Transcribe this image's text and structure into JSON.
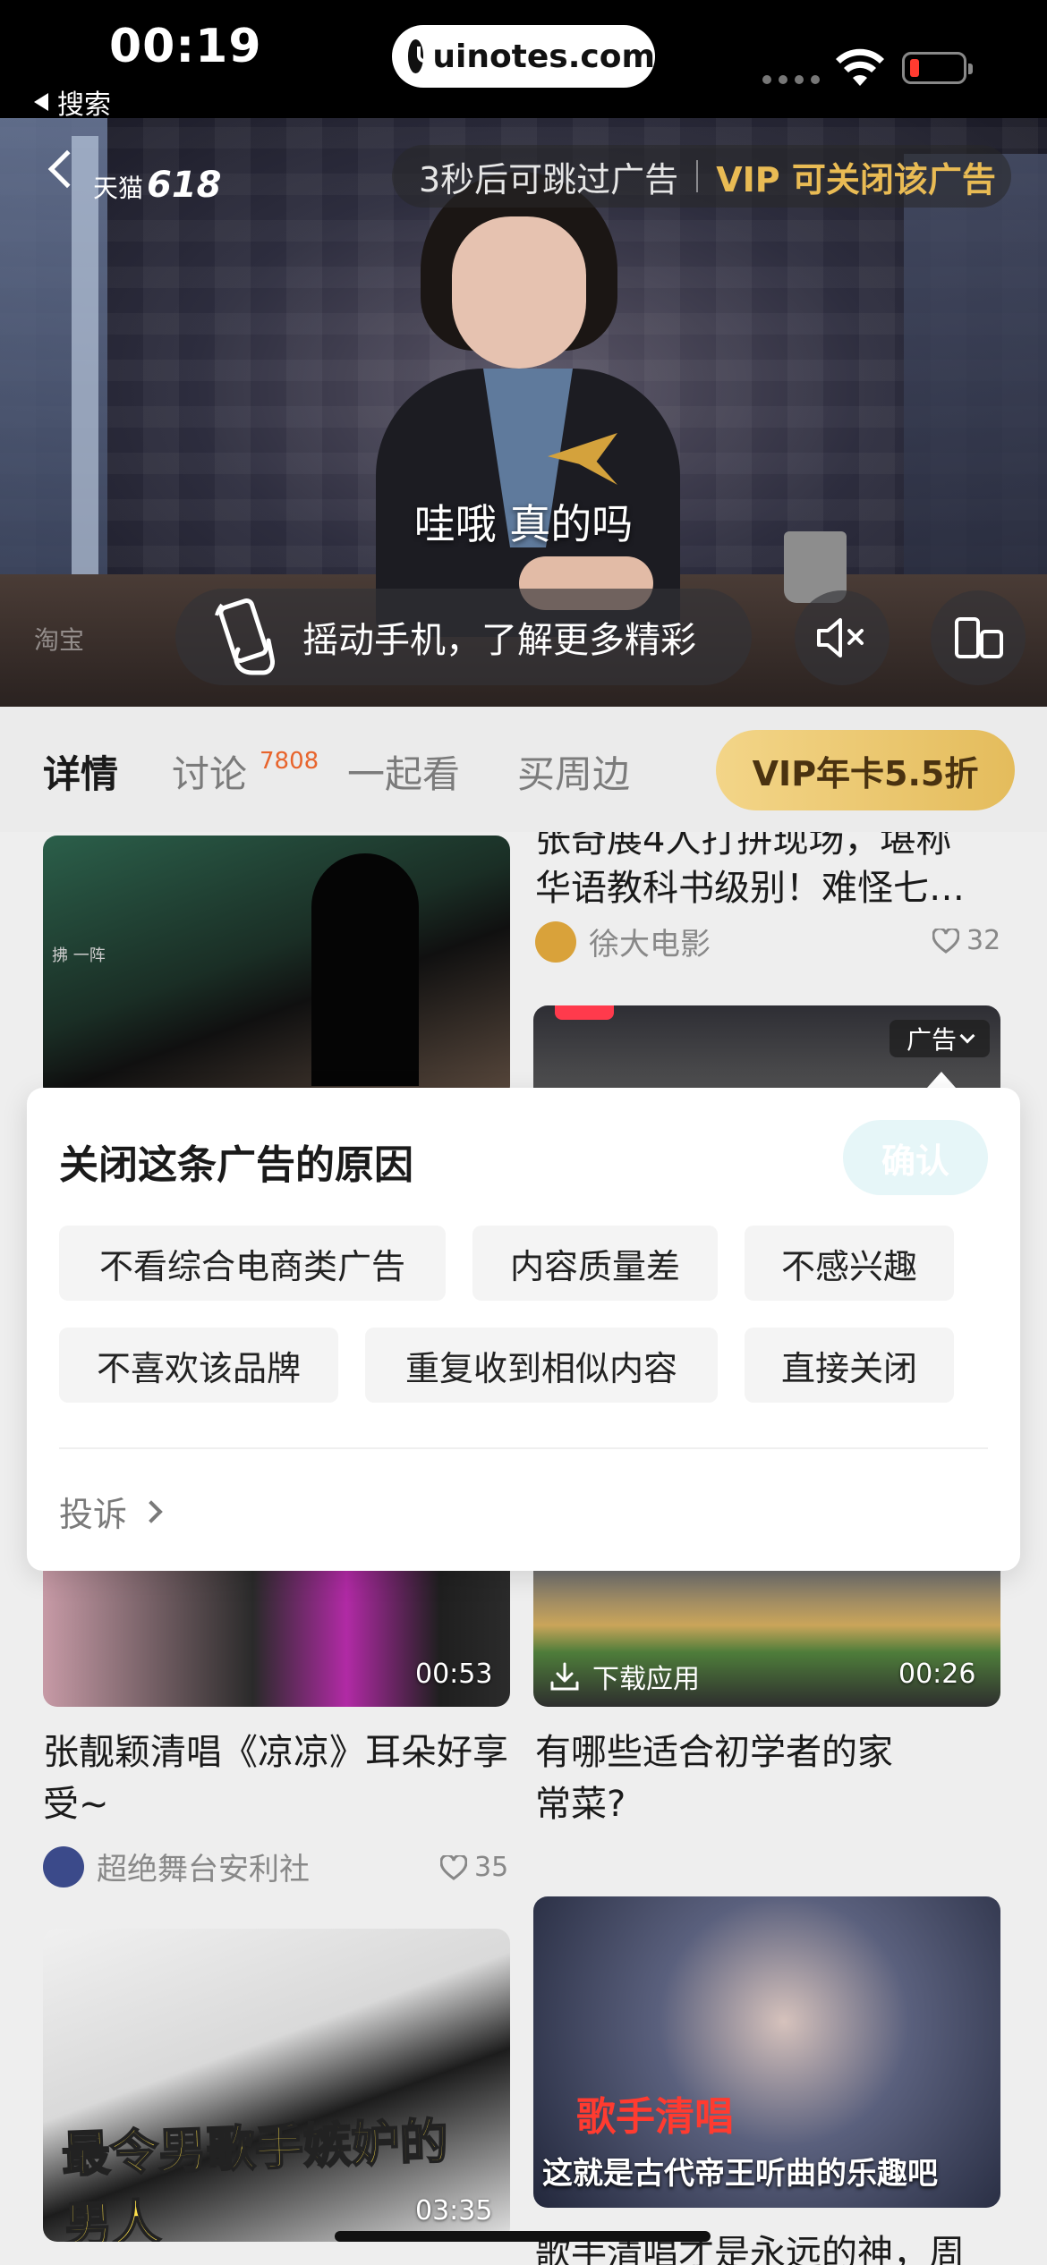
{
  "status_bar": {
    "time": "00:19",
    "back_label": "搜索",
    "url": "uinotes.com"
  },
  "video_ad": {
    "brand": "天猫",
    "brand_number": "618",
    "skip_text": "3秒后可跳过广告",
    "vip_close": "VIP 可关闭该广告",
    "subtitle": "哇哦 真的吗",
    "watermark": "淘宝",
    "shake_text": "摇动手机，了解更多精彩"
  },
  "tabs": {
    "items": [
      {
        "label": "详情"
      },
      {
        "label": "讨论"
      },
      {
        "label": "一起看"
      },
      {
        "label": "买周边"
      }
    ],
    "discussion_count": "7808",
    "vip_button": "VIP年卡5.5折"
  },
  "feed": {
    "top_left_caption": "拂 一阵",
    "top_right": {
      "title_partial": "张奇展4人打拼现场，堪称",
      "title": "华语教科书级别！难怪七…",
      "author": "徐大电影",
      "likes": "32"
    },
    "ad_tag": "广告",
    "mid_left": {
      "duration": "00:53",
      "title": "张靓颖清唱《凉凉》耳朵好享受~",
      "author": "超绝舞台安利社",
      "likes": "35"
    },
    "mid_right": {
      "download_label": "下载应用",
      "duration": "00:26",
      "title": "有哪些适合初学者的家常菜?"
    },
    "bottom_left": {
      "overlay_text": "最令男歌手嫉妒的男人",
      "duration": "03:35"
    },
    "bottom_right": {
      "red_text": "歌手清唱",
      "caption": "这就是古代帝王听曲的乐趣吧",
      "title": "歌手清唱才是永远的神，周"
    }
  },
  "dialog": {
    "title": "关闭这条广告的原因",
    "confirm": "确认",
    "reasons": [
      "不看综合电商类广告",
      "内容质量差",
      "不感兴趣",
      "不喜欢该品牌",
      "重复收到相似内容",
      "直接关闭"
    ],
    "complain": "投诉"
  },
  "colors": {
    "vip_gold": "#e9bb54",
    "count_orange": "#e8642c",
    "confirm_disabled": "#e6f6f8"
  }
}
